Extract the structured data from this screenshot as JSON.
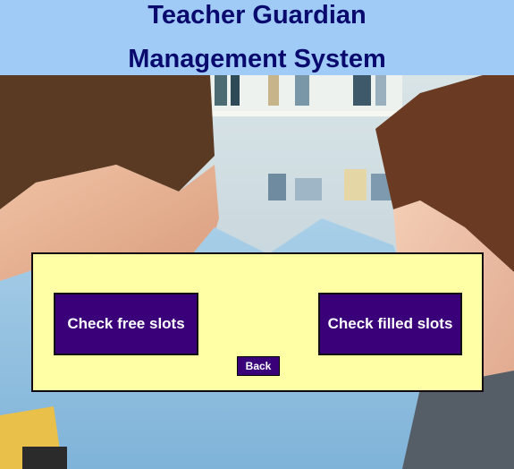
{
  "header": {
    "title_line1": "Teacher Guardian",
    "title_line2": "Management System"
  },
  "panel": {
    "check_free_label": "Check free slots",
    "check_filled_label": "Check filled slots",
    "back_label": "Back"
  },
  "colors": {
    "header_bg": "#9fcbf6",
    "title_text": "#0a0a6e",
    "panel_bg": "#ffffa6",
    "button_bg": "#3a007a",
    "button_text": "#ffffff"
  }
}
